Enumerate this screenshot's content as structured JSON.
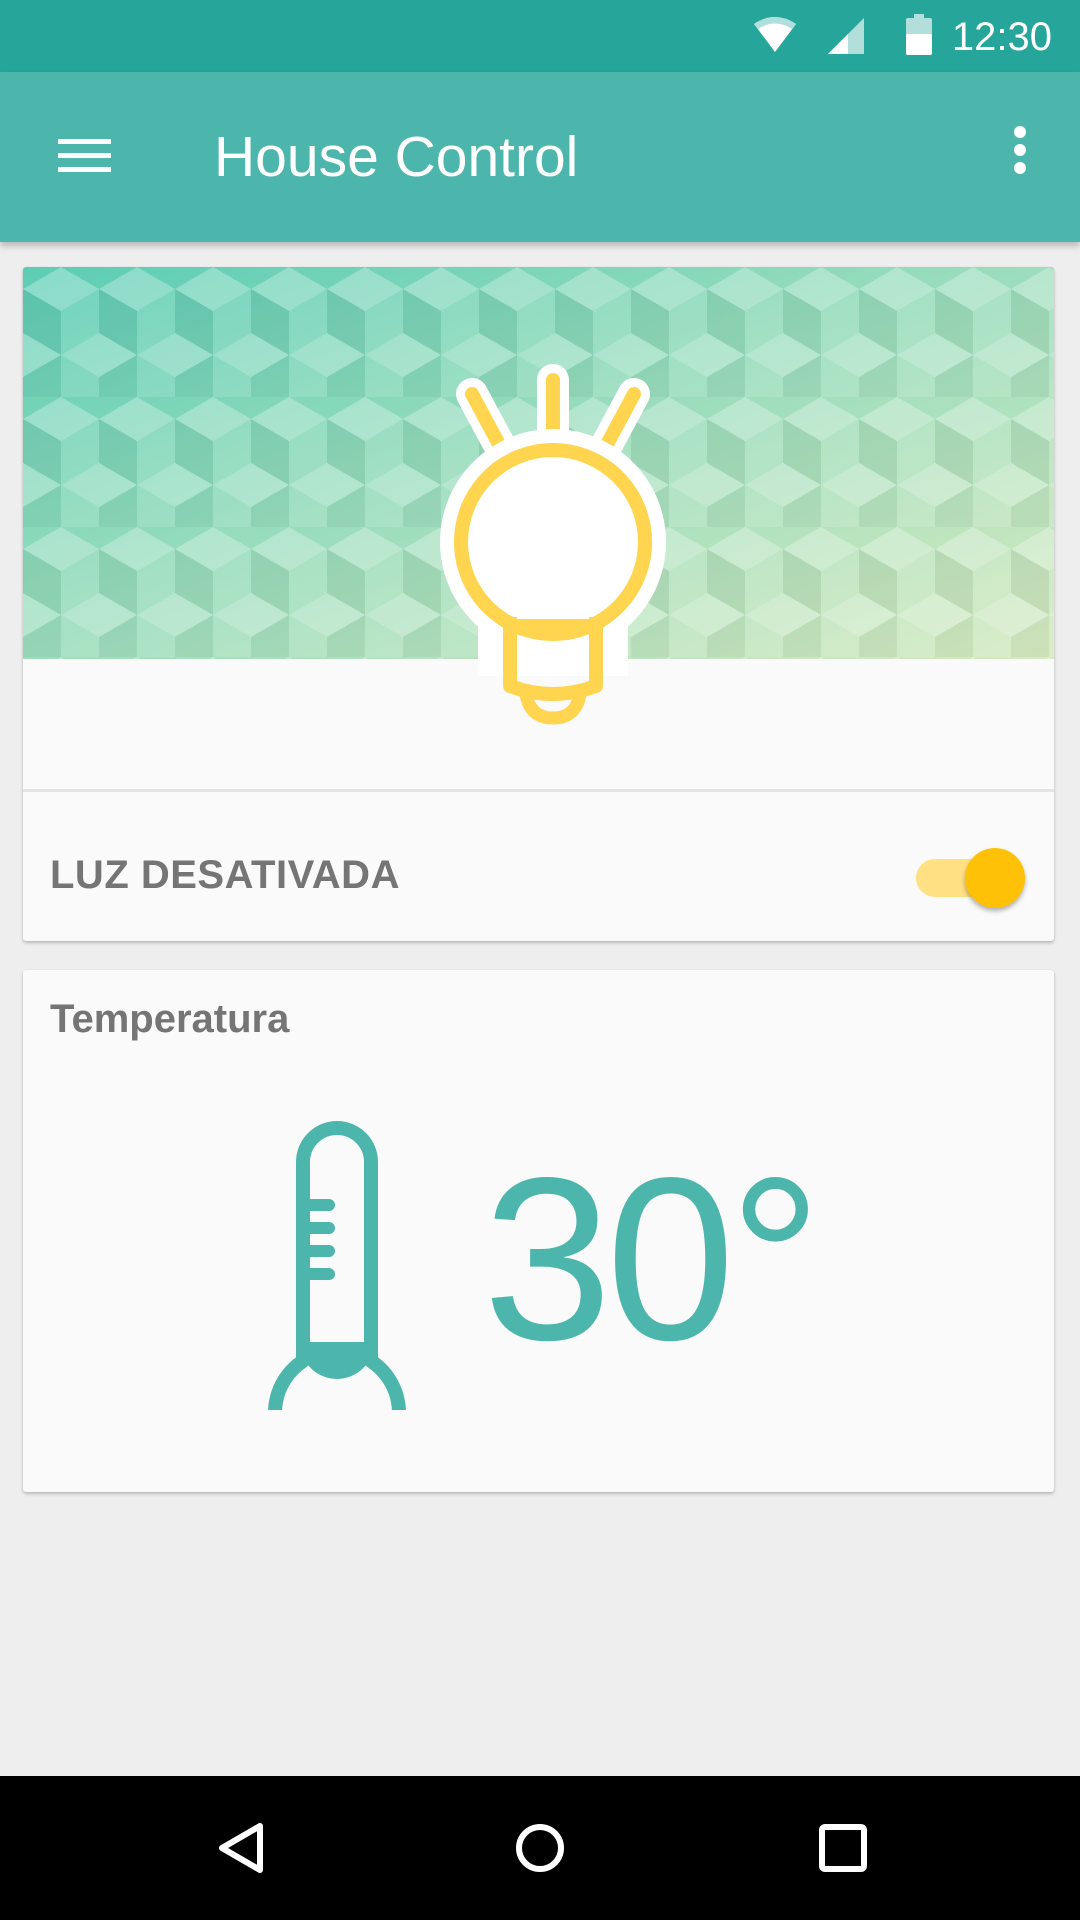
{
  "status_bar": {
    "time": "12:30",
    "icons": [
      "wifi-icon",
      "cellular-signal-icon",
      "battery-icon"
    ],
    "background_color": "#26a69a"
  },
  "app_bar": {
    "title": "House Control",
    "menu_icon": "hamburger-menu-icon",
    "overflow_icon": "more-vertical-icon",
    "background_color": "#4db6ac"
  },
  "light_card": {
    "banner_icon": "light-bulb-icon",
    "status_label": "LUZ DESATIVADA",
    "switch_on": true,
    "switch_color": "#ffc107"
  },
  "temperature_card": {
    "title": "Temperatura",
    "icon": "thermometer-icon",
    "value": "30°",
    "accent_color": "#4db6ac"
  },
  "nav_bar": {
    "buttons": [
      "back-icon",
      "home-icon",
      "recents-icon"
    ]
  }
}
